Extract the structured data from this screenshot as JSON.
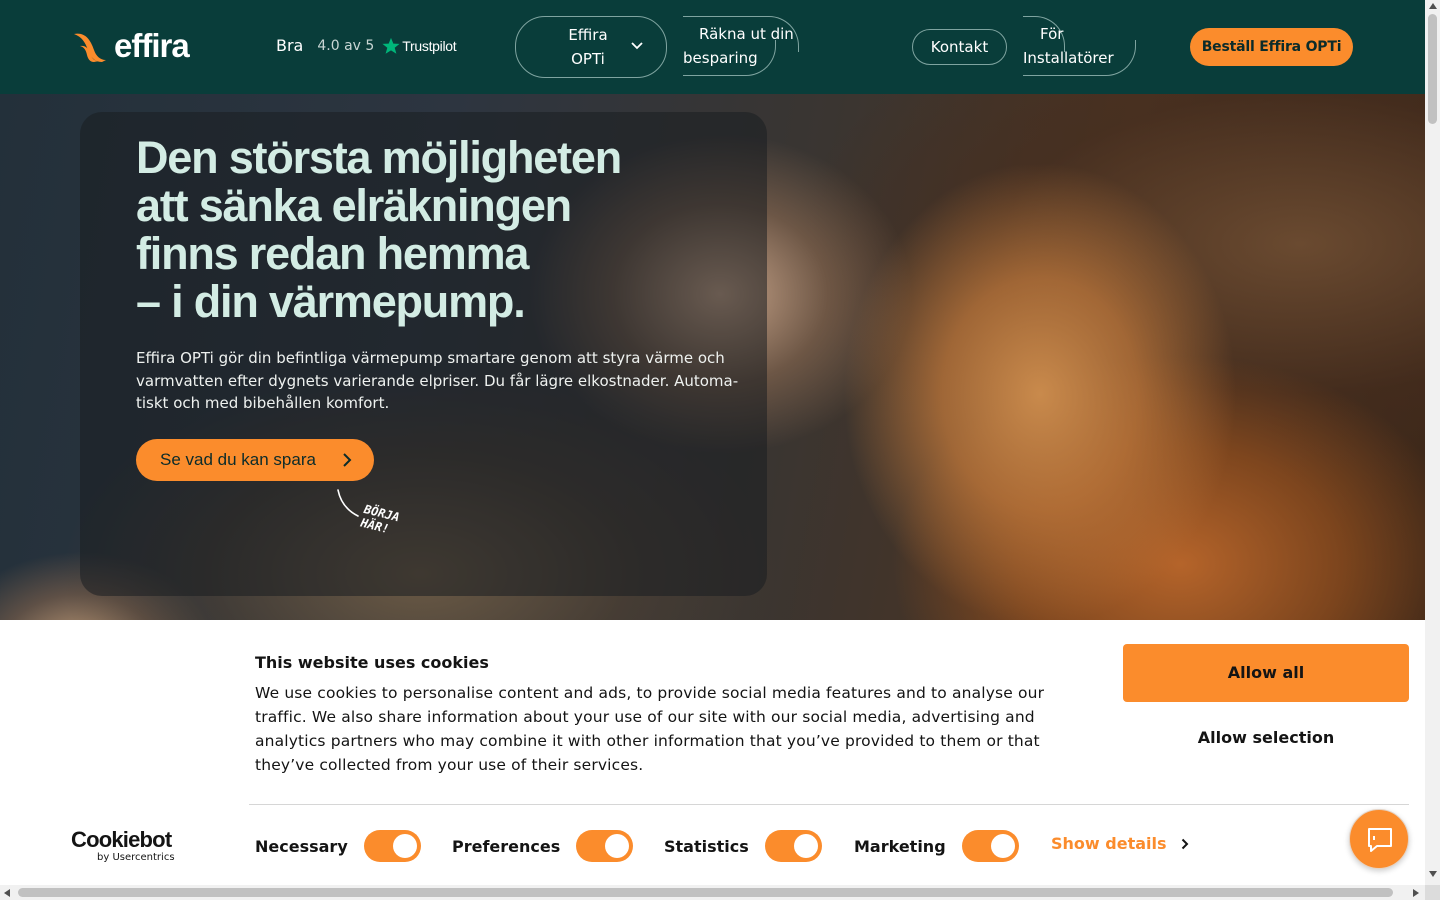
{
  "header": {
    "logo_text": "effira",
    "trustpilot": {
      "rating_word": "Bra",
      "score_text": "4.0 av 5",
      "brand": "Trustpilot"
    },
    "nav": {
      "opti_label": "Effira OPTi",
      "rakna_label": "Räkna ut din besparing",
      "kontakt_label": "Kontakt",
      "installatorer_label": "För Installatörer"
    },
    "order_label": "Beställ Effira OPTi"
  },
  "hero": {
    "title_lines": [
      "Den största möjligheten",
      "att sänka elräkningen",
      "finns redan hemma",
      "– i din värmepump."
    ],
    "description_lines": [
      "Effira OPTi gör din befintliga värmepump smartare genom att styra värme och",
      "varmvatten efter dygnets varierande elpriser. Du får lägre elkostnader. Automa-",
      "tiskt och med bibehållen komfort."
    ],
    "cta_label": "Se vad du kan spara",
    "handnote_lines": [
      "BÖRJA",
      "HÄR!"
    ]
  },
  "cookie_banner": {
    "title": "This website uses cookies",
    "body_lines": [
      "We use cookies to personalise content and ads, to provide social media features and to analyse our",
      "traffic. We also share information about your use of our site with our social media, advertising and",
      "analytics partners who may combine it with other information that you’ve provided to them or that",
      "they’ve collected from your use of their services."
    ],
    "allow_all_label": "Allow all",
    "allow_selection_label": "Allow selection",
    "logo_main": "Cookiebot",
    "logo_sub": "by Usercentrics",
    "categories": [
      {
        "label": "Necessary",
        "checked": true
      },
      {
        "label": "Preferences",
        "checked": true
      },
      {
        "label": "Statistics",
        "checked": true
      },
      {
        "label": "Marketing",
        "checked": true
      }
    ],
    "show_details_label": "Show details"
  },
  "icons": {
    "chevron": "chevron-down-icon",
    "cta_arrow": "chevron-right-icon",
    "chat": "chat-icon",
    "star": "star-icon"
  },
  "colors": {
    "header_bg": "#093d3a",
    "accent": "#fb8c2c",
    "hero_title": "#d3ece4"
  }
}
